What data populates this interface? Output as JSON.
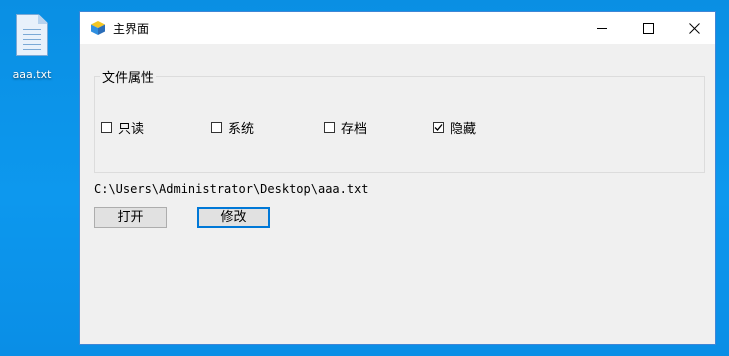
{
  "desktop": {
    "icons": [
      {
        "label": "aaa.txt",
        "icon": "text-file-icon"
      }
    ]
  },
  "window": {
    "title": "主界面",
    "controls": {
      "minimize": "minimize-icon",
      "maximize": "maximize-icon",
      "close": "close-icon"
    },
    "group": {
      "label": "文件属性",
      "checkboxes": [
        {
          "label": "只读",
          "checked": false
        },
        {
          "label": "系统",
          "checked": false
        },
        {
          "label": "存档",
          "checked": false
        },
        {
          "label": "隐藏",
          "checked": true
        }
      ]
    },
    "path": "C:\\Users\\Administrator\\Desktop\\aaa.txt",
    "buttons": {
      "open": "打开",
      "modify": "修改"
    }
  },
  "colors": {
    "desktop": "#0d98ee",
    "window_border": "#3f86d6",
    "window_bg": "#f0f0f0",
    "focus": "#0078d7"
  }
}
